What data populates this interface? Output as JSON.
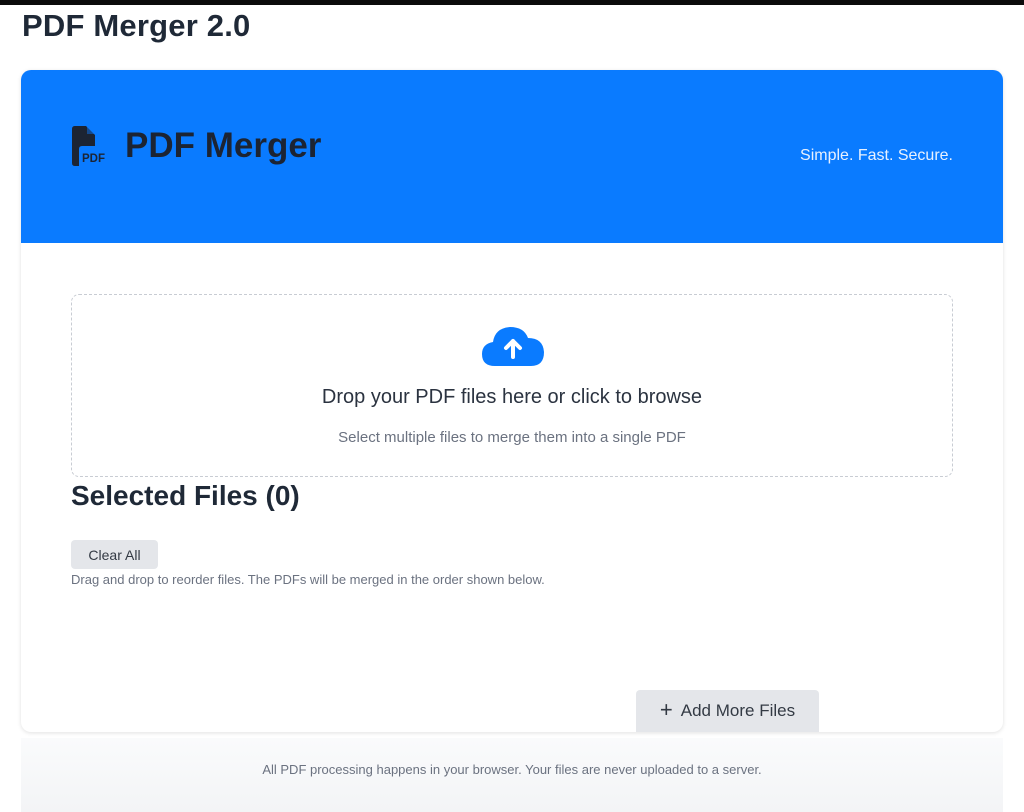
{
  "page": {
    "title": "PDF Merger 2.0"
  },
  "hero": {
    "brand_title": "PDF Merger",
    "tagline": "Simple. Fast. Secure.",
    "logo_icon": "pdf-file-icon",
    "background_color": "#0a7bff"
  },
  "dropzone": {
    "icon": "cloud-upload-icon",
    "title": "Drop your PDF files here or click to browse",
    "subtitle": "Select multiple files to merge them into a single PDF"
  },
  "files": {
    "heading": "Selected Files (0)",
    "clear_label": "Clear All",
    "hint": "Drag and drop to reorder files. The PDFs will be merged in the order shown below.",
    "items": []
  },
  "actions": {
    "add_more_label": "Add More Files",
    "add_icon": "plus-icon"
  },
  "footer": {
    "text": "All PDF processing happens in your browser. Your files are never uploaded to a server."
  }
}
